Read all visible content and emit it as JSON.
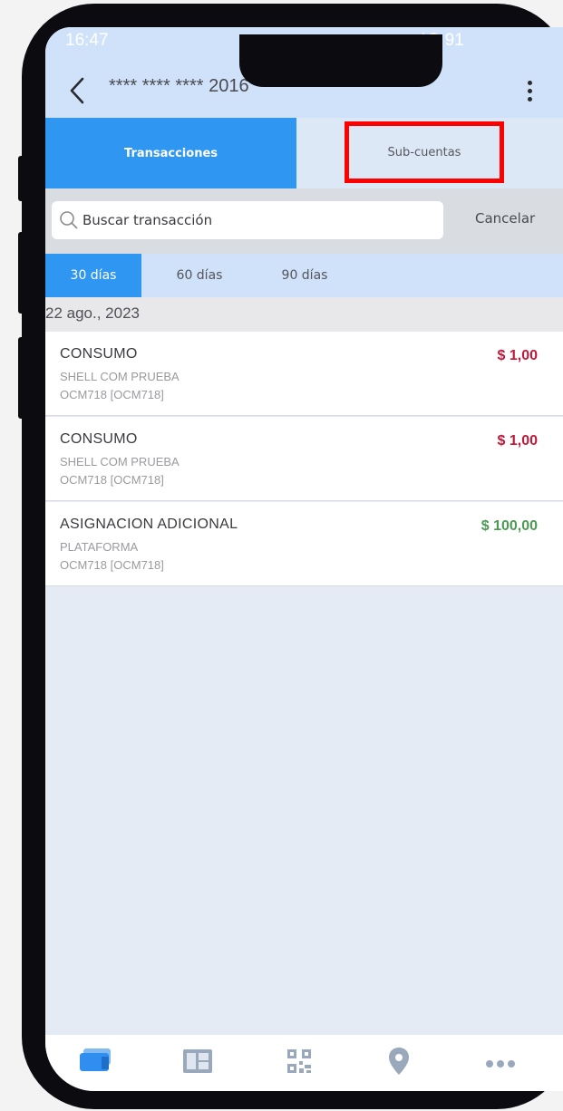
{
  "status": {
    "time": "16:47",
    "indicators": "4G  91"
  },
  "header": {
    "title": "**** **** **** 2016",
    "back_icon": "chevron-left-icon",
    "menu_icon": "more-vertical-icon"
  },
  "tabs": [
    {
      "label": "Transacciones",
      "active": true
    },
    {
      "label": "Sub-cuentas",
      "active": false,
      "highlighted": true
    }
  ],
  "search": {
    "placeholder": "Buscar transacción",
    "cancel_label": "Cancelar"
  },
  "periods": [
    {
      "label": "30 días",
      "active": true
    },
    {
      "label": "60 días",
      "active": false
    },
    {
      "label": "90 días",
      "active": false
    }
  ],
  "date_header": "22 ago., 2023",
  "transactions": [
    {
      "title": "CONSUMO",
      "merchant": "SHELL COM PRUEBA",
      "reference": "OCM718 [OCM718]",
      "amount": "$  1,00",
      "color": "#c0183a"
    },
    {
      "title": "CONSUMO",
      "merchant": "SHELL COM PRUEBA",
      "reference": "OCM718 [OCM718]",
      "amount": "$  1,00",
      "color": "#c0183a"
    },
    {
      "title": "ASIGNACION ADICIONAL",
      "merchant": "PLATAFORMA",
      "reference": "OCM718 [OCM718]",
      "amount": "$  100,00",
      "color": "#4b9a54"
    }
  ],
  "bottom_nav": [
    {
      "icon": "cards-icon",
      "active": true
    },
    {
      "icon": "statement-icon",
      "active": false
    },
    {
      "icon": "qr-code-icon",
      "active": false
    },
    {
      "icon": "location-pin-icon",
      "active": false
    },
    {
      "icon": "more-horizontal-icon",
      "active": false
    }
  ],
  "colors": {
    "accent": "#2f96f1",
    "highlight_box": "#ff0000",
    "debit": "#c0183a",
    "credit": "#4b9a54",
    "header_bg": "#cfe2f9"
  }
}
